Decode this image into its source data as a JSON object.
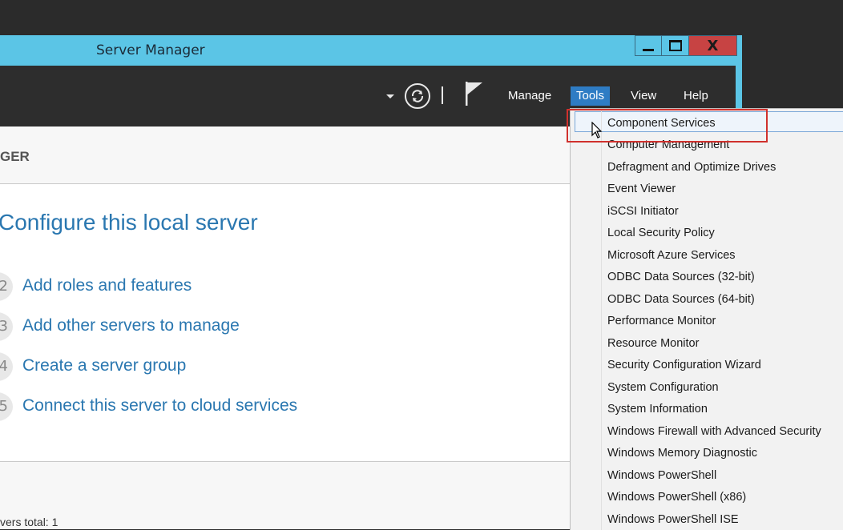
{
  "window": {
    "title": "Server Manager",
    "close_glyph": "X"
  },
  "toolbar": {
    "menu": [
      "Manage",
      "Tools",
      "View",
      "Help"
    ],
    "active_menu": "Tools"
  },
  "content": {
    "breadcrumb": "GER",
    "configure_title": "Configure this local server",
    "steps": [
      {
        "num": "2",
        "label": "Add roles and features"
      },
      {
        "num": "3",
        "label": "Add other servers to manage"
      },
      {
        "num": "4",
        "label": "Create a server group"
      },
      {
        "num": "5",
        "label": "Connect this server to cloud services"
      }
    ],
    "servers_total": "vers total: 1"
  },
  "tools_menu": {
    "items": [
      "Component Services",
      "Computer Management",
      "Defragment and Optimize Drives",
      "Event Viewer",
      "iSCSI Initiator",
      "Local Security Policy",
      "Microsoft Azure Services",
      "ODBC Data Sources (32-bit)",
      "ODBC Data Sources (64-bit)",
      "Performance Monitor",
      "Resource Monitor",
      "Security Configuration Wizard",
      "System Configuration",
      "System Information",
      "Windows Firewall with Advanced Security",
      "Windows Memory Diagnostic",
      "Windows PowerShell",
      "Windows PowerShell (x86)",
      "Windows PowerShell ISE"
    ],
    "highlighted": "Component Services"
  },
  "colors": {
    "titlebar": "#5bc5e6",
    "toolbar": "#2d2d2d",
    "accent": "#2e7cc4",
    "link": "#2a77b0",
    "close": "#c74343",
    "highlight_box": "#d0312d"
  }
}
